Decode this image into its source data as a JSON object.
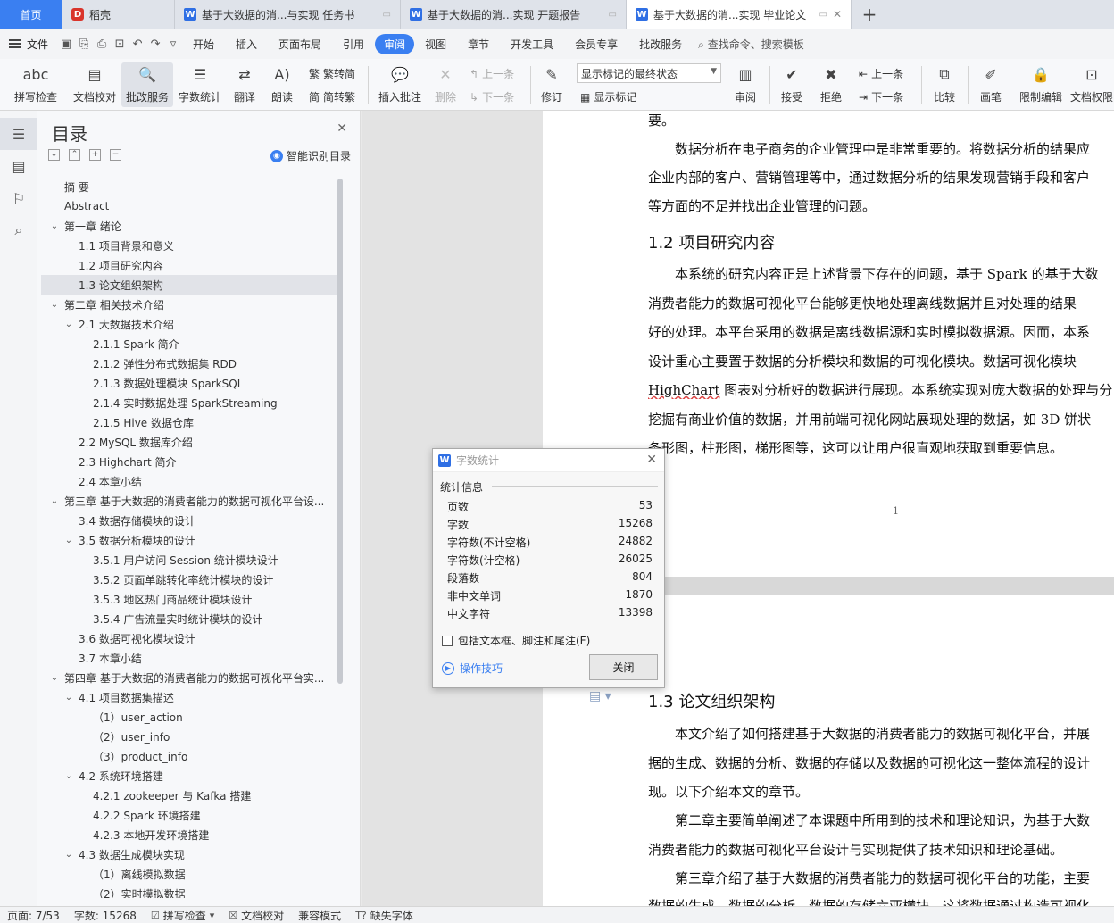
{
  "tabs": [
    {
      "label": "首页"
    },
    {
      "label": "稻壳"
    },
    {
      "label": "基于大数据的消...与实现 任务书"
    },
    {
      "label": "基于大数据的消...实现 开题报告"
    },
    {
      "label": "基于大数据的消...实现 毕业论文"
    }
  ],
  "menu": {
    "file": "文件",
    "items": [
      "开始",
      "插入",
      "页面布局",
      "引用",
      "审阅",
      "视图",
      "章节",
      "开发工具",
      "会员专享",
      "批改服务"
    ],
    "active": "审阅",
    "search": "查找命令、搜索模板"
  },
  "ribbon": {
    "spell": "拼写检查",
    "doc_check": "文档校对",
    "revise_service": "批改服务",
    "word_count": "字数统计",
    "translate": "翻译",
    "read_aloud": "朗读",
    "trad": "繁转简",
    "simp": "简转繁",
    "insert_comment": "插入批注",
    "delete": "删除",
    "prev": "上一条",
    "next": "下一条",
    "track": "修订",
    "markup_select": "显示标记的最终状态",
    "show_markup": "显示标记",
    "review": "审阅",
    "accept": "接受",
    "reject": "拒绝",
    "prev2": "上一条",
    "next2": "下一条",
    "compare": "比较",
    "pen": "画笔",
    "restrict": "限制编辑",
    "doc_perm": "文档权限"
  },
  "toc": {
    "title": "目录",
    "smart": "智能识别目录",
    "items": [
      {
        "label": "摘  要",
        "level": 0,
        "arrow": ""
      },
      {
        "label": "Abstract",
        "level": 0,
        "arrow": ""
      },
      {
        "label": "第一章  绪论",
        "level": 0,
        "arrow": "v"
      },
      {
        "label": "1.1 项目背景和意义",
        "level": 1,
        "arrow": ""
      },
      {
        "label": "1.2 项目研究内容",
        "level": 1,
        "arrow": ""
      },
      {
        "label": "1.3 论文组织架构",
        "level": 1,
        "arrow": "",
        "selected": true
      },
      {
        "label": "第二章  相关技术介绍",
        "level": 0,
        "arrow": "v"
      },
      {
        "label": "2.1 大数据技术介绍",
        "level": 1,
        "arrow": "v"
      },
      {
        "label": "2.1.1  Spark 简介",
        "level": 2,
        "arrow": ""
      },
      {
        "label": "2.1.2  弹性分布式数据集 RDD",
        "level": 2,
        "arrow": ""
      },
      {
        "label": "2.1.3 数据处理模块 SparkSQL",
        "level": 2,
        "arrow": ""
      },
      {
        "label": "2.1.4 实时数据处理 SparkStreaming",
        "level": 2,
        "arrow": ""
      },
      {
        "label": "2.1.5 Hive 数据仓库",
        "level": 2,
        "arrow": ""
      },
      {
        "label": "2.2 MySQL 数据库介绍",
        "level": 1,
        "arrow": ""
      },
      {
        "label": "2.3 Highchart 简介",
        "level": 1,
        "arrow": ""
      },
      {
        "label": "2.4   本章小结",
        "level": 1,
        "arrow": ""
      },
      {
        "label": "第三章  基于大数据的消费者能力的数据可视化平台设...",
        "level": 0,
        "arrow": "v"
      },
      {
        "label": "3.4 数据存储模块的设计",
        "level": 1,
        "arrow": ""
      },
      {
        "label": "3.5 数据分析模块的设计",
        "level": 1,
        "arrow": "v"
      },
      {
        "label": "3.5.1   用户访问 Session 统计模块设计",
        "level": 2,
        "arrow": ""
      },
      {
        "label": "3.5.2   页面单跳转化率统计模块的设计",
        "level": 2,
        "arrow": ""
      },
      {
        "label": "3.5.3   地区热门商品统计模块设计",
        "level": 2,
        "arrow": ""
      },
      {
        "label": "3.5.4 广告流量实时统计模块的设计",
        "level": 2,
        "arrow": ""
      },
      {
        "label": "3.6 数据可视化模块设计",
        "level": 1,
        "arrow": ""
      },
      {
        "label": "3.7   本章小结",
        "level": 1,
        "arrow": ""
      },
      {
        "label": "第四章  基于大数据的消费者能力的数据可视化平台实...",
        "level": 0,
        "arrow": "v"
      },
      {
        "label": "4.1 项目数据集描述",
        "level": 1,
        "arrow": "v"
      },
      {
        "label": "（1）user_action",
        "level": 2,
        "arrow": ""
      },
      {
        "label": "（2）user_info",
        "level": 2,
        "arrow": ""
      },
      {
        "label": "（3）product_info",
        "level": 2,
        "arrow": ""
      },
      {
        "label": "4.2 系统环境搭建",
        "level": 1,
        "arrow": "v"
      },
      {
        "label": "4.2.1 zookeeper 与 Kafka 搭建",
        "level": 2,
        "arrow": ""
      },
      {
        "label": "4.2.2 Spark 环境搭建",
        "level": 2,
        "arrow": ""
      },
      {
        "label": "4.2.3 本地开发环境搭建",
        "level": 2,
        "arrow": ""
      },
      {
        "label": "4.3 数据生成模块实现",
        "level": 1,
        "arrow": "v"
      },
      {
        "label": "（1）离线模拟数据",
        "level": 2,
        "arrow": ""
      },
      {
        "label": "（2）实时模拟数据",
        "level": 2,
        "arrow": ""
      }
    ]
  },
  "doc": {
    "p1": [
      "要。",
      "　　数据分析在电子商务的企业管理中是非常重要的。将数据分析的结果应",
      "企业内部的客户、营销管理等中，通过数据分析的结果发现营销手段和客户",
      "等方面的不足并找出企业管理的问题。"
    ],
    "h12": "1.2 项目研究内容",
    "p2": [
      "　　本系统的研究内容正是上述背景下存在的问题，基于 Spark 的基于大数",
      "消费者能力的数据可视化平台能够更快地处理离线数据并且对处理的结果",
      "好的处理。本平台采用的数据是离线数据源和实时模拟数据源。因而，本系",
      "设计重心主要置于数据的分析模块和数据的可视化模块。数据可视化模块",
      "图表对分析好的数据进行展现。本系统实现对庞大数据的处理与分",
      "挖掘有商业价值的数据，并用前端可视化网站展现处理的数据，如 3D 饼状",
      "条形图，柱形图，梯形图等，这可以让用户很直观地获取到重要信息。"
    ],
    "highchart_word": "HighChart",
    "page_number": "1",
    "h13": "1.3 论文组织架构",
    "p3": [
      "　　本文介绍了如何搭建基于大数据的消费者能力的数据可视化平台，并展",
      "据的生成、数据的分析、数据的存储以及数据的可视化这一整体流程的设计",
      "现。以下介绍本文的章节。",
      "　　第二章主要简单阐述了本课题中所用到的技术和理论知识，为基于大数",
      "消费者能力的数据可视化平台设计与实现提供了技术知识和理论基础。",
      "　　第三章介绍了基于大数据的消费者能力的数据可视化平台的功能，主要",
      "数据的生成、数据的分析、数据的存储六亚横块，这将数据通过构造可视化"
    ]
  },
  "dialog": {
    "title": "字数统计",
    "group": "统计信息",
    "stats": [
      {
        "label": "页数",
        "value": "53"
      },
      {
        "label": "字数",
        "value": "15268"
      },
      {
        "label": "字符数(不计空格)",
        "value": "24882"
      },
      {
        "label": "字符数(计空格)",
        "value": "26025"
      },
      {
        "label": "段落数",
        "value": "804"
      },
      {
        "label": "非中文单词",
        "value": "1870"
      },
      {
        "label": "中文字符",
        "value": "13398"
      }
    ],
    "checkbox": "包括文本框、脚注和尾注(F)",
    "tips": "操作技巧",
    "close": "关闭"
  },
  "status": {
    "page": "页面: 7/53",
    "words": "字数: 15268",
    "spell": "拼写检查",
    "doc_check": "文档校对",
    "compat": "兼容模式",
    "missing_font": "缺失字体"
  }
}
